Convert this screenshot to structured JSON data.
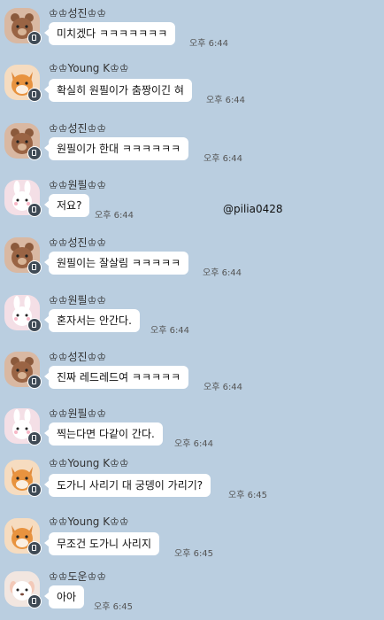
{
  "watermark": "@pilia0428",
  "messages": [
    {
      "sender": "♔♔성진♔♔",
      "text": "미치겠다 ㅋㅋㅋㅋㅋㅋㅋ",
      "time": "오후 6:44",
      "avatar": "bear-avatar"
    },
    {
      "sender": "♔♔Young K♔♔",
      "text": "확실히 원필이가 춤짱이긴 혀",
      "time": "오후 6:44",
      "avatar": "fox-avatar"
    },
    {
      "sender": "♔♔성진♔♔",
      "text": "원필이가 한대 ㅋㅋㅋㅋㅋㅋ",
      "time": "오후 6:44",
      "avatar": "bear-avatar"
    },
    {
      "sender": "♔♔원필♔♔",
      "text": "저요?",
      "time": "오후 6:44",
      "avatar": "bunny-avatar"
    },
    {
      "sender": "♔♔성진♔♔",
      "text": "원필이는 잘살림 ㅋㅋㅋㅋㅋ",
      "time": "오후 6:44",
      "avatar": "bear-avatar"
    },
    {
      "sender": "♔♔원필♔♔",
      "text": "혼자서는 안간다.",
      "time": "오후 6:44",
      "avatar": "bunny-avatar"
    },
    {
      "sender": "♔♔성진♔♔",
      "text": "진짜 레드레드여 ㅋㅋㅋㅋㅋ",
      "time": "오후 6:44",
      "avatar": "bear-avatar"
    },
    {
      "sender": "♔♔원필♔♔",
      "text": "찍는다면 다같이 간다.",
      "time": "오후 6:44",
      "avatar": "bunny-avatar"
    },
    {
      "sender": "♔♔Young K♔♔",
      "text": "도가니 사리기 대 궁뎅이 가리기?",
      "time": "오후 6:45",
      "avatar": "fox-avatar"
    },
    {
      "sender": "♔♔Young K♔♔",
      "text": "무조건 도가니 사리지",
      "time": "오후 6:45",
      "avatar": "fox-avatar"
    },
    {
      "sender": "♔♔도운♔♔",
      "text": "아아",
      "time": "오후 6:45",
      "avatar": "puppy-avatar"
    }
  ]
}
